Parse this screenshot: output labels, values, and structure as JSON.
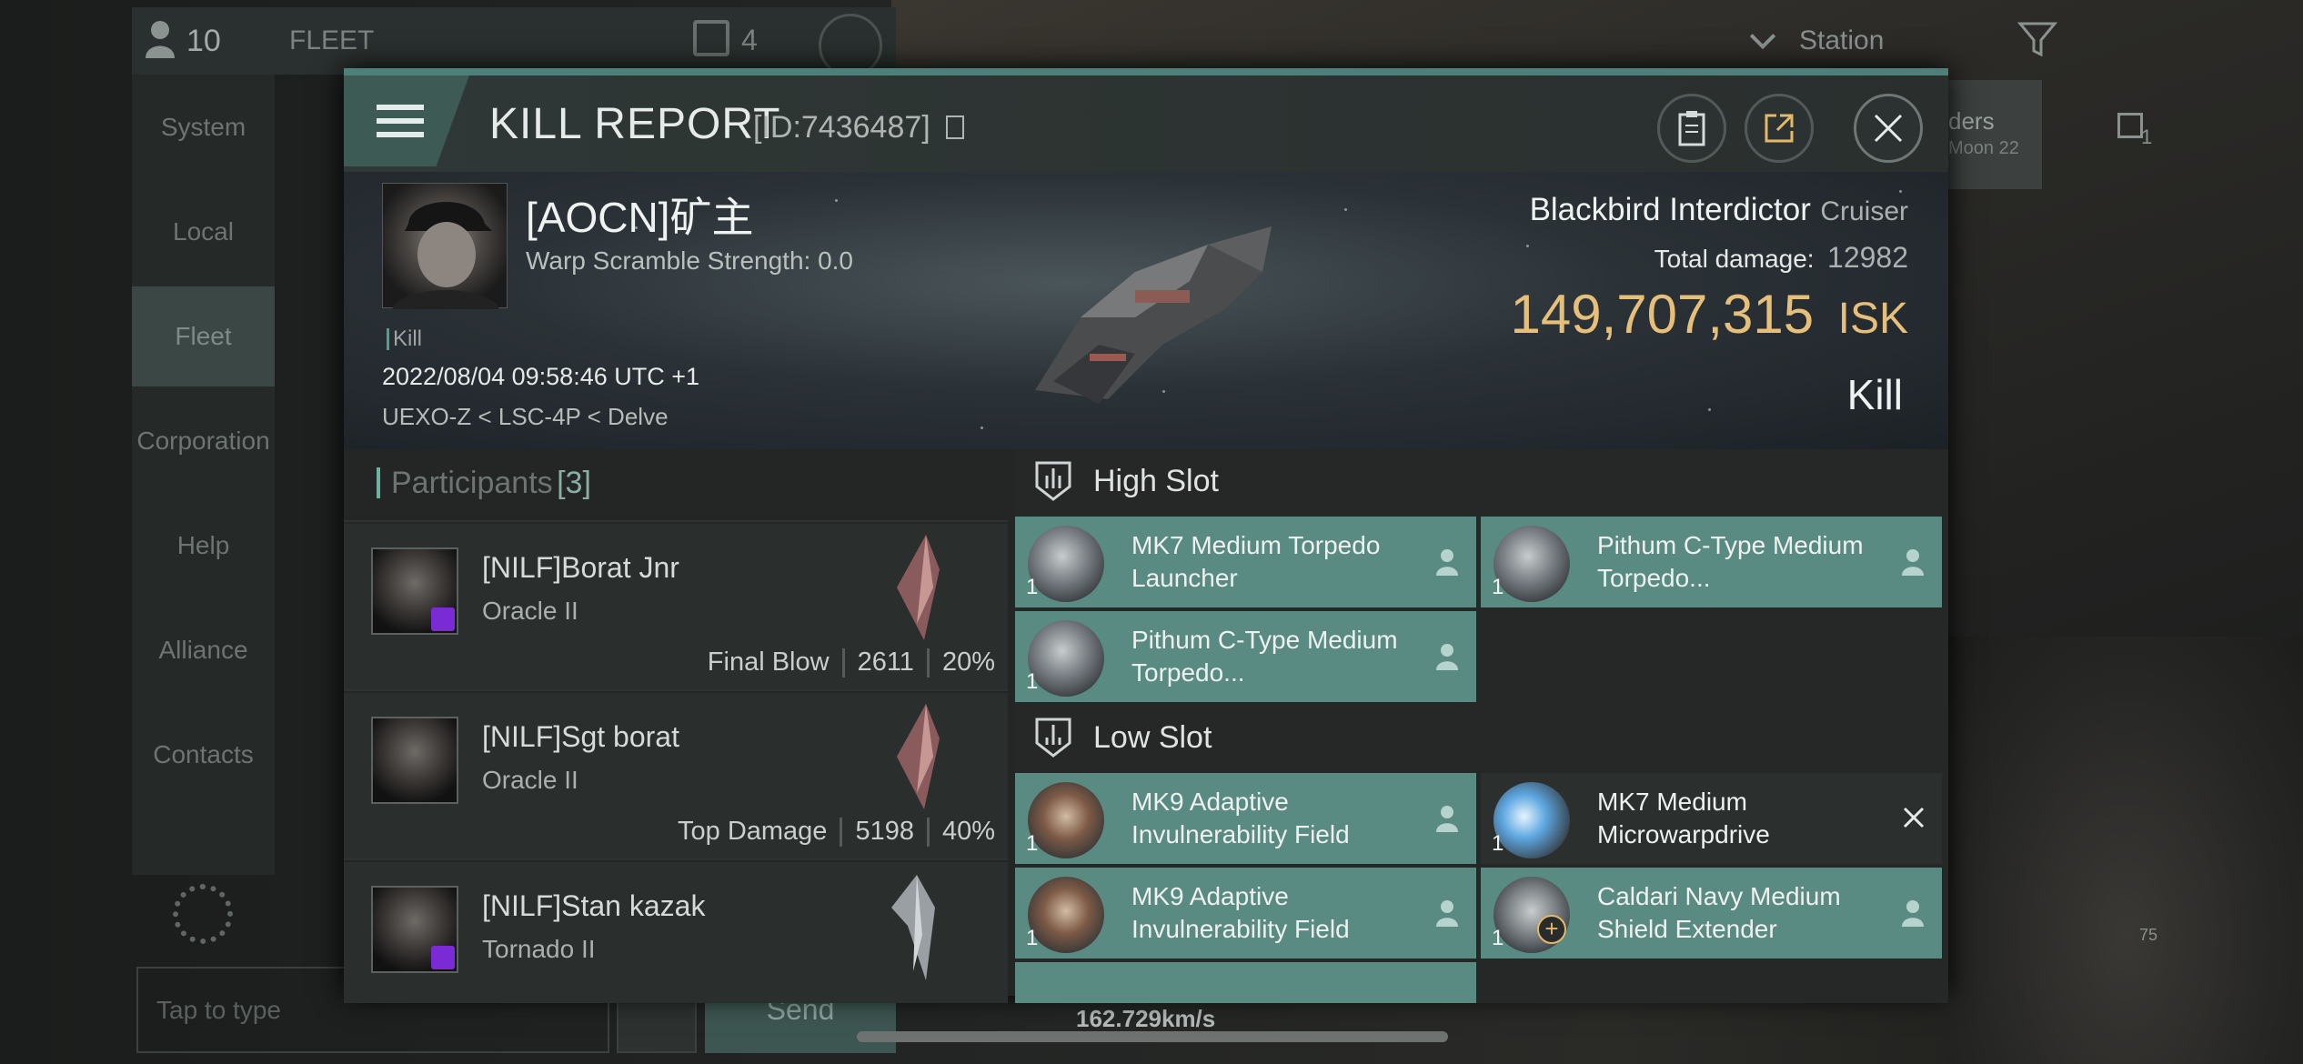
{
  "background": {
    "fleet_count": "10",
    "fleet_title": "FLEET",
    "fleet_box_count": "4",
    "station_label": "Station",
    "sidebar": [
      {
        "label": "System"
      },
      {
        "label": "Local"
      },
      {
        "label": "Fleet"
      },
      {
        "label": "Corporation"
      },
      {
        "label": "Help"
      },
      {
        "label": "Alliance"
      },
      {
        "label": "Contacts"
      }
    ],
    "chat_placeholder": "Tap to type",
    "send_label": "Send",
    "speed": "162.729km/s",
    "partial_label": "ders",
    "partial_sub": "Moon 22",
    "counter": "1",
    "small_number": "75"
  },
  "report": {
    "title": "KILL REPORT",
    "id": "[ID:7436487]",
    "victim_name": "[AOCN]矿主",
    "warp_scramble": "Warp Scramble Strength: 0.0",
    "tag": "Kill",
    "datetime": "2022/08/04 09:58:46 UTC +1",
    "location": "UEXO-Z < LSC-4P < Delve",
    "ship_name": "Blackbird Interdictor",
    "ship_class": "Cruiser",
    "damage_label": "Total damage:",
    "damage_value": "12982",
    "isk_value": "149,707,315",
    "isk_unit": "ISK",
    "result": "Kill",
    "accent_color": "#4e807a",
    "isk_color": "#e6c07a"
  },
  "participants": {
    "label": "Participants",
    "count": "[3]",
    "items": [
      {
        "name": "[NILF]Borat Jnr",
        "ship": "Oracle II",
        "stat_label": "Final Blow",
        "damage": "2611",
        "percent": "20%"
      },
      {
        "name": "[NILF]Sgt borat",
        "ship": "Oracle II",
        "stat_label": "Top Damage",
        "damage": "5198",
        "percent": "40%"
      },
      {
        "name": "[NILF]Stan kazak",
        "ship": "Tornado II"
      }
    ]
  },
  "slots": {
    "high": {
      "label": "High Slot",
      "modules": [
        {
          "name": "MK7 Medium Torpedo Launcher",
          "qty": "1"
        },
        {
          "name": "Pithum C-Type Medium Torpedo...",
          "qty": "1"
        },
        {
          "name": "Pithum C-Type Medium Torpedo...",
          "qty": "1"
        }
      ]
    },
    "low": {
      "label": "Low Slot",
      "modules": [
        {
          "name": "MK9 Adaptive Invulnerability Field",
          "qty": "1"
        },
        {
          "name": "MK7 Medium Microwarpdrive",
          "qty": "1"
        },
        {
          "name": "MK9 Adaptive Invulnerability Field",
          "qty": "1"
        },
        {
          "name": "Caldari Navy Medium Shield Extender",
          "qty": "1"
        }
      ]
    }
  }
}
